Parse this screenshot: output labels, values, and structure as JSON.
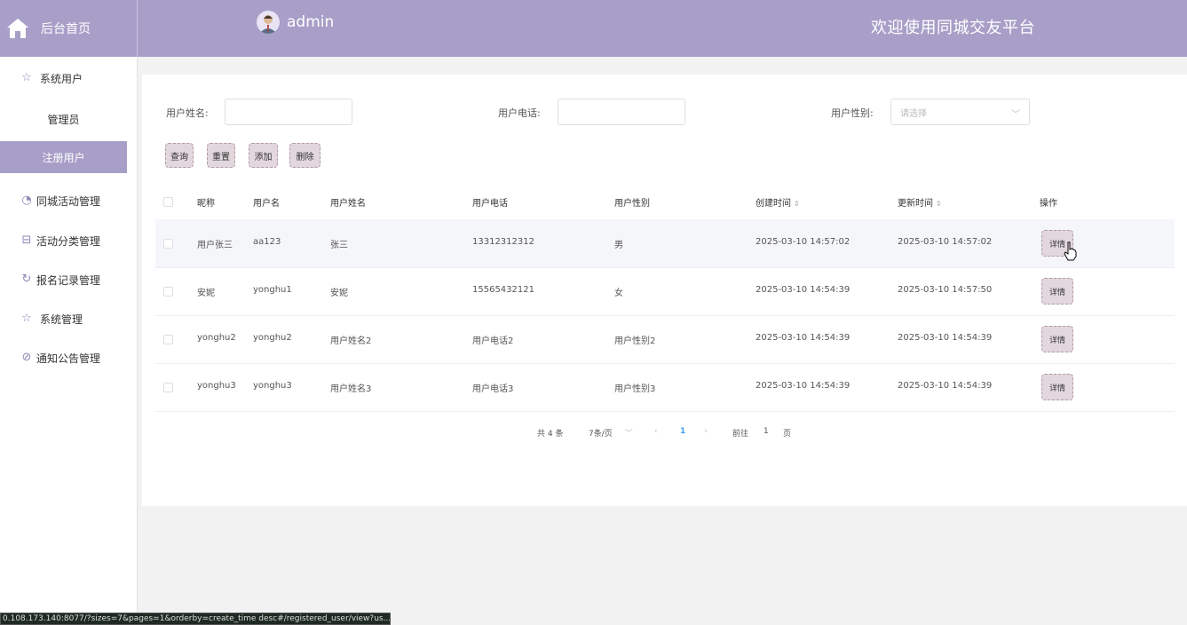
{
  "header": {
    "home_label": "后台首页",
    "username": "admin",
    "welcome": "欢迎使用同城交友平台"
  },
  "sidebar": {
    "items": [
      {
        "label": "系统用户",
        "icon": "star-icon"
      },
      {
        "label": "管理员"
      },
      {
        "label": "注册用户",
        "active": true
      },
      {
        "label": "同城活动管理",
        "icon": "clock-icon"
      },
      {
        "label": "活动分类管理",
        "icon": "gift-icon"
      },
      {
        "label": "报名记录管理",
        "icon": "refresh-icon"
      },
      {
        "label": "系统管理",
        "icon": "star-icon"
      },
      {
        "label": "通知公告管理",
        "icon": "compass-icon"
      }
    ]
  },
  "search": {
    "name_label": "用户姓名:",
    "name_value": "",
    "phone_label": "用户电话:",
    "phone_value": "",
    "gender_label": "用户性别:",
    "gender_placeholder": "请选择"
  },
  "actions": {
    "query": "查询",
    "reset": "重置",
    "add": "添加",
    "delete": "删除"
  },
  "table": {
    "headers": [
      "昵称",
      "用户名",
      "用户姓名",
      "用户电话",
      "用户性别",
      "创建时间",
      "更新时间",
      "操作"
    ],
    "rows": [
      {
        "nickname": "用户张三",
        "username": "aa123",
        "realname": "张三",
        "phone": "13312312312",
        "gender": "男",
        "created": "2025-03-10 14:57:02",
        "updated": "2025-03-10 14:57:02",
        "action": "详情"
      },
      {
        "nickname": "安妮",
        "username": "yonghu1",
        "realname": "安妮",
        "phone": "15565432121",
        "gender": "女",
        "created": "2025-03-10 14:54:39",
        "updated": "2025-03-10 14:57:50",
        "action": "详情"
      },
      {
        "nickname": "yonghu2",
        "username": "yonghu2",
        "realname": "用户姓名2",
        "phone": "用户电话2",
        "gender": "用户性别2",
        "created": "2025-03-10 14:54:39",
        "updated": "2025-03-10 14:54:39",
        "action": "详情"
      },
      {
        "nickname": "yonghu3",
        "username": "yonghu3",
        "realname": "用户姓名3",
        "phone": "用户电话3",
        "gender": "用户性别3",
        "created": "2025-03-10 14:54:39",
        "updated": "2025-03-10 14:54:39",
        "action": "详情"
      }
    ]
  },
  "pagination": {
    "total": "共 4 条",
    "page_size": "7条/页",
    "current_page": "1",
    "goto_prefix": "前往",
    "goto_value": "1",
    "goto_suffix": "页"
  },
  "statusbar": {
    "url": "0.108.173.140:8077/?sizes=7&pages=1&orderby=create_time desc#/registered_user/view?us..."
  },
  "colors": {
    "brand": "#a89fc8",
    "button_bg": "#e3d7de",
    "page_link": "#409eff"
  }
}
